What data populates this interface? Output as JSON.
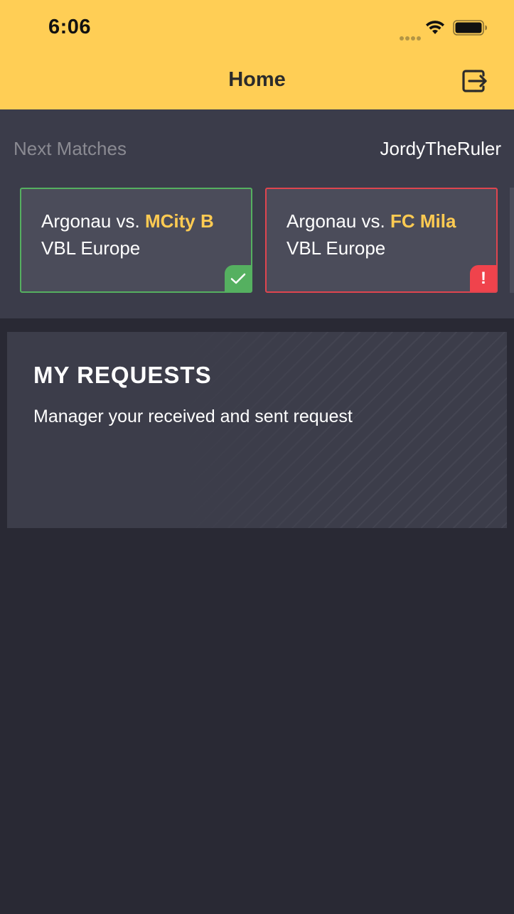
{
  "status_bar": {
    "time": "6:06"
  },
  "nav": {
    "title": "Home",
    "logout_icon": "logout-icon"
  },
  "matches": {
    "label": "Next Matches",
    "username": "JordyTheRuler",
    "cards": [
      {
        "home": "Argonau vs. ",
        "opponent": "MCity B",
        "league": "VBL Europe",
        "status": "confirmed",
        "status_icon": "checkmark-icon",
        "color": "#55B060"
      },
      {
        "home": "Argonau vs. ",
        "opponent": "FC Mila",
        "league": "VBL Europe",
        "status": "alert",
        "status_icon": "exclamation-icon",
        "badge_text": "!",
        "color": "#F0434C"
      }
    ]
  },
  "requests": {
    "title": "MY REQUESTS",
    "subtitle": "Manager your received and sent request"
  },
  "colors": {
    "accent": "#FFCE55",
    "background": "#292934",
    "card": "#4B4C5A",
    "highlight": "#FFCB52"
  }
}
